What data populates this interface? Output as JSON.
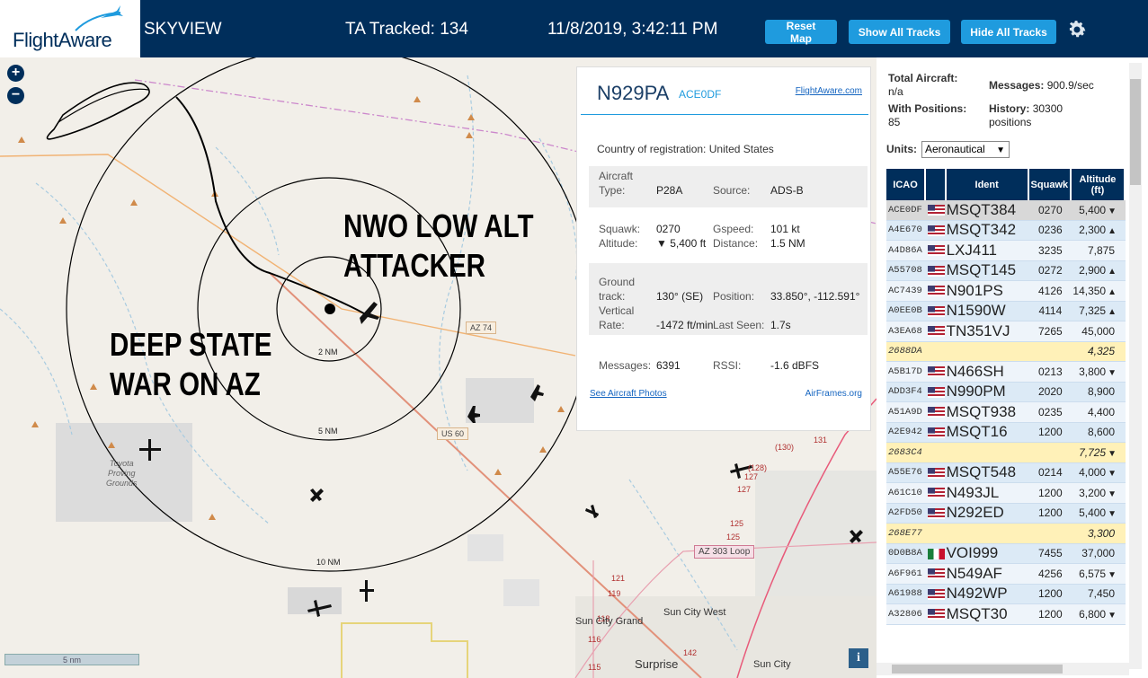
{
  "header": {
    "logo": "FlightAware",
    "app_name": "SKYVIEW",
    "tracked": "TA Tracked: 134",
    "datetime": "11/8/2019, 3:42:11 PM",
    "btn_reset": "Reset Map",
    "btn_show": "Show All Tracks",
    "btn_hide": "Hide All Tracks",
    "settings_icon": "gear-icon",
    "brand_color": "#002e5b",
    "button_color": "#1f9bde"
  },
  "map": {
    "zoom_in": "+",
    "zoom_out": "−",
    "overlay_top": "NWO LOW ALT\nATTACKER",
    "overlay_left": "DEEP STATE\nWAR ON AZ",
    "range_labels": [
      "2 NM",
      "5 NM",
      "10 NM"
    ],
    "road_labels": [
      "AZ 74",
      "US 60",
      "AZ 303 Loop"
    ],
    "place_labels": [
      "Toyota\nProving\nGrounds",
      "Sun City Grand",
      "Sun City West",
      "Surprise",
      "Sun City"
    ],
    "route_numbers": [
      "(130)",
      "131",
      "(128)",
      "127",
      "125",
      "125",
      "121",
      "119",
      "118",
      "116",
      "115",
      "142",
      "127"
    ],
    "scale": "5 nm",
    "info": "i"
  },
  "popup": {
    "registration": "N929PA",
    "hex": "ACE0DF",
    "fa_link": "FlightAware.com",
    "country_label": "Country of registration:",
    "country_value": "United States",
    "aircraft_type_label": "Aircraft\nType:",
    "aircraft_type_value": "P28A",
    "source_label": "Source:",
    "source_value": "ADS-B",
    "squawk_label": "Squawk:",
    "squawk_value": "0270",
    "gspeed_label": "Gspeed:",
    "gspeed_value": "101 kt",
    "altitude_label": "Altitude:",
    "altitude_value": "▼ 5,400 ft",
    "distance_label": "Distance:",
    "distance_value": "1.5 NM",
    "ground_track_label": "Ground\ntrack:",
    "ground_track_value": "130° (SE)",
    "position_label": "Position:",
    "position_value": "33.850°, -112.591°",
    "vertical_rate_label": "Vertical\nRate:",
    "vertical_rate_value": "-1472 ft/min",
    "last_seen_label": "Last Seen:",
    "last_seen_value": "1.7s",
    "messages_label": "Messages:",
    "messages_value": "6391",
    "rssi_label": "RSSI:",
    "rssi_value": "-1.6 dBFS",
    "photos_link": "See Aircraft Photos",
    "airframes_link": "AirFrames.org"
  },
  "panel": {
    "total_label": "Total Aircraft:",
    "total_value": "n/a",
    "messages_label": "Messages:",
    "messages_value": "900.9/sec",
    "positions_label": "With Positions:",
    "positions_value": "85",
    "history_label": "History:",
    "history_value": "30300",
    "history_suffix": "positions",
    "units_label": "Units:",
    "units_value": "Aeronautical",
    "columns": [
      "ICAO",
      "",
      "Ident",
      "Squawk",
      "Altitude\n(ft)"
    ],
    "rows": [
      {
        "icao": "ACE0DF",
        "flag": "US",
        "ident": "MSQT384",
        "squawk": "0270",
        "alt": "5,400",
        "vr": "▼",
        "state": "selected"
      },
      {
        "icao": "A4E670",
        "flag": "US",
        "ident": "MSQT342",
        "squawk": "0236",
        "alt": "2,300",
        "vr": "▲",
        "state": ""
      },
      {
        "icao": "A4D86A",
        "flag": "US",
        "ident": "LXJ411",
        "squawk": "3235",
        "alt": "7,875",
        "vr": "",
        "state": ""
      },
      {
        "icao": "A55708",
        "flag": "US",
        "ident": "MSQT145",
        "squawk": "0272",
        "alt": "2,900",
        "vr": "▲",
        "state": ""
      },
      {
        "icao": "AC7439",
        "flag": "US",
        "ident": "N901PS",
        "squawk": "4126",
        "alt": "14,350",
        "vr": "▲",
        "state": ""
      },
      {
        "icao": "A0EE0B",
        "flag": "US",
        "ident": "N1590W",
        "squawk": "4114",
        "alt": "7,325",
        "vr": "▲",
        "state": ""
      },
      {
        "icao": "A3EA68",
        "flag": "US",
        "ident": "TN351VJ",
        "squawk": "7265",
        "alt": "45,000",
        "vr": "",
        "state": ""
      },
      {
        "icao": "2688DA",
        "flag": "",
        "ident": "",
        "squawk": "",
        "alt": "4,325",
        "vr": "",
        "state": "mlat"
      },
      {
        "icao": "A5B17D",
        "flag": "US",
        "ident": "N466SH",
        "squawk": "0213",
        "alt": "3,800",
        "vr": "▼",
        "state": ""
      },
      {
        "icao": "ADD3F4",
        "flag": "US",
        "ident": "N990PM",
        "squawk": "2020",
        "alt": "8,900",
        "vr": "",
        "state": ""
      },
      {
        "icao": "A51A9D",
        "flag": "US",
        "ident": "MSQT938",
        "squawk": "0235",
        "alt": "4,400",
        "vr": "",
        "state": ""
      },
      {
        "icao": "A2E942",
        "flag": "US",
        "ident": "MSQT16",
        "squawk": "1200",
        "alt": "8,600",
        "vr": "",
        "state": ""
      },
      {
        "icao": "2683C4",
        "flag": "",
        "ident": "",
        "squawk": "",
        "alt": "7,725",
        "vr": "▼",
        "state": "mlat"
      },
      {
        "icao": "A55E76",
        "flag": "US",
        "ident": "MSQT548",
        "squawk": "0214",
        "alt": "4,000",
        "vr": "▼",
        "state": ""
      },
      {
        "icao": "A61C10",
        "flag": "US",
        "ident": "N493JL",
        "squawk": "1200",
        "alt": "3,200",
        "vr": "▼",
        "state": ""
      },
      {
        "icao": "A2FD50",
        "flag": "US",
        "ident": "N292ED",
        "squawk": "1200",
        "alt": "5,400",
        "vr": "▼",
        "state": ""
      },
      {
        "icao": "268E77",
        "flag": "",
        "ident": "",
        "squawk": "",
        "alt": "3,300",
        "vr": "",
        "state": "mlat"
      },
      {
        "icao": "0D0B8A",
        "flag": "MX",
        "ident": "VOI999",
        "squawk": "7455",
        "alt": "37,000",
        "vr": "",
        "state": ""
      },
      {
        "icao": "A6F961",
        "flag": "US",
        "ident": "N549AF",
        "squawk": "4256",
        "alt": "6,575",
        "vr": "▼",
        "state": ""
      },
      {
        "icao": "A61988",
        "flag": "US",
        "ident": "N492WP",
        "squawk": "1200",
        "alt": "7,450",
        "vr": "",
        "state": ""
      },
      {
        "icao": "A32806",
        "flag": "US",
        "ident": "MSQT30",
        "squawk": "1200",
        "alt": "6,800",
        "vr": "▼",
        "state": ""
      }
    ]
  }
}
